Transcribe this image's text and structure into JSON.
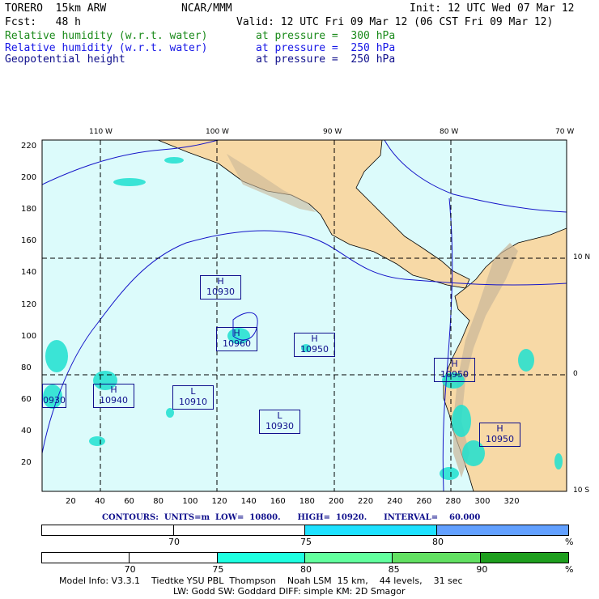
{
  "header": {
    "model": "TORERO  15km ARW",
    "org": "NCAR/MMM",
    "init": "Init: 12 UTC Wed 07 Mar 12",
    "fcst": "Fcst:   48 h",
    "valid": "Valid: 12 UTC Fri 09 Mar 12 (06 CST Fri 09 Mar 12)"
  },
  "fields": [
    {
      "name": "Relative humidity (w.r.t. water)",
      "level": "at pressure =  300 hPa",
      "color": "#1a8a1a"
    },
    {
      "name": "Relative humidity (w.r.t. water)",
      "level": "at pressure =  250 hPa",
      "color": "#1515e6"
    },
    {
      "name": "Geopotential height",
      "level": "at pressure =  250 hPa",
      "color": "#0f0f8c"
    }
  ],
  "axes": {
    "top": [
      "110 W",
      "100 W",
      "90 W",
      "80 W",
      "70 W"
    ],
    "right": [
      "10 N",
      "0",
      "10 S"
    ],
    "x": [
      "20",
      "40",
      "60",
      "80",
      "100",
      "120",
      "140",
      "160",
      "180",
      "200",
      "220",
      "240",
      "260",
      "280",
      "300",
      "320"
    ],
    "y": [
      "220",
      "200",
      "180",
      "160",
      "140",
      "120",
      "100",
      "80",
      "60",
      "40",
      "20"
    ]
  },
  "systems": [
    {
      "type": "H",
      "value": "10930"
    },
    {
      "type": "H",
      "value": "10960"
    },
    {
      "type": "H",
      "value": "10950"
    },
    {
      "type": "H",
      "value": "10950"
    },
    {
      "type": "H",
      "value": "10940"
    },
    {
      "type": "L",
      "value": "10910"
    },
    {
      "type": "L",
      "value": "10930"
    },
    {
      "type": "H",
      "value": "10950"
    },
    {
      "type": "H",
      "value": "0930"
    }
  ],
  "contours": "CONTOURS:  UNITS=m  LOW=  10800.      HIGH=  10920.      INTERVAL=    60.000",
  "scale250": {
    "labels": [
      "70",
      "75",
      "80",
      "%"
    ],
    "colors": [
      "#ffffff",
      "#ffffff",
      "#1ee1ff",
      "#62a0ff"
    ]
  },
  "scale300": {
    "labels": [
      "70",
      "75",
      "80",
      "85",
      "90",
      "%"
    ],
    "colors": [
      "#ffffff",
      "#ffffff",
      "#1effe0",
      "#62ff9e",
      "#62e062",
      "#1e9e1e"
    ]
  },
  "footer": {
    "line1": "Model Info: V3.3.1    Tiedtke YSU PBL  Thompson    Noah LSM  15 km,    44 levels,    31 sec",
    "line2": "LW: Godd SW: Goddard DIFF: simple KM: 2D Smagor"
  }
}
